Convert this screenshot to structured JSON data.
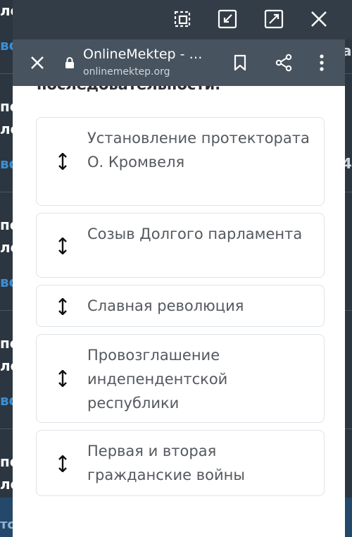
{
  "background": {
    "left_fragments": [
      "ле",
      "во",
      "по",
      "ле",
      "во",
      "по",
      "ле",
      "во",
      "по",
      "ле",
      "во",
      "по",
      "ле",
      "то"
    ],
    "right_fragments": [
      "а.",
      "4"
    ]
  },
  "window_controls": {
    "icons": [
      "picture-in-picture-icon",
      "minimize-icon",
      "maximize-icon",
      "close-icon"
    ]
  },
  "browser": {
    "title": "OnlineMektep - …",
    "url": "onlinemektep.org"
  },
  "content": {
    "heading_partial": "последовательности.",
    "items": [
      {
        "text": "Установление протектората О. Кромвеля"
      },
      {
        "text": "Созыв Долгого парламента"
      },
      {
        "text": "Славная революция"
      },
      {
        "text": "Провозглашение индепендентской республики"
      },
      {
        "text": "Первая и вторая гражданские войны"
      }
    ]
  },
  "colors": {
    "panel_bg": "#ffffff",
    "chrome_bg": "#47535e",
    "window_bar_bg": "#333d47",
    "link_blue": "#3a8fd6",
    "item_text": "#55595e",
    "item_border": "#dfe3e7"
  }
}
